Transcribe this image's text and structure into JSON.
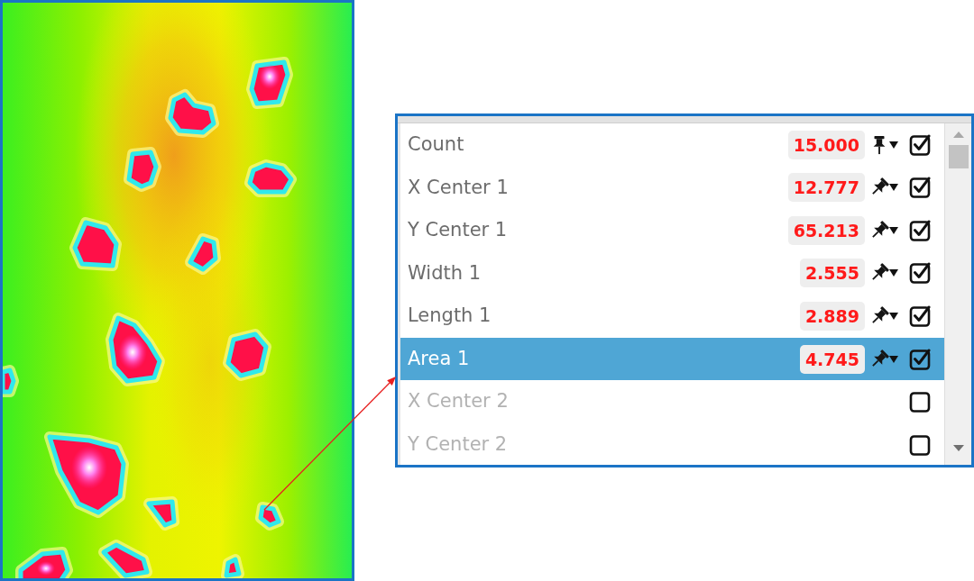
{
  "measurements": [
    {
      "label": "Count",
      "value": "15.000",
      "pinned": true,
      "checked": true,
      "selected": false
    },
    {
      "label": "X Center 1",
      "value": "12.777",
      "pinned": false,
      "checked": true,
      "selected": false
    },
    {
      "label": "Y Center 1",
      "value": "65.213",
      "pinned": false,
      "checked": true,
      "selected": false
    },
    {
      "label": "Width 1",
      "value": "2.555",
      "pinned": false,
      "checked": true,
      "selected": false
    },
    {
      "label": "Length 1",
      "value": "2.889",
      "pinned": false,
      "checked": true,
      "selected": false
    },
    {
      "label": "Area 1",
      "value": "4.745",
      "pinned": false,
      "checked": true,
      "selected": true
    },
    {
      "label": "X Center 2",
      "checked": false,
      "selected": false
    },
    {
      "label": "Y Center 2",
      "checked": false,
      "selected": false
    }
  ]
}
